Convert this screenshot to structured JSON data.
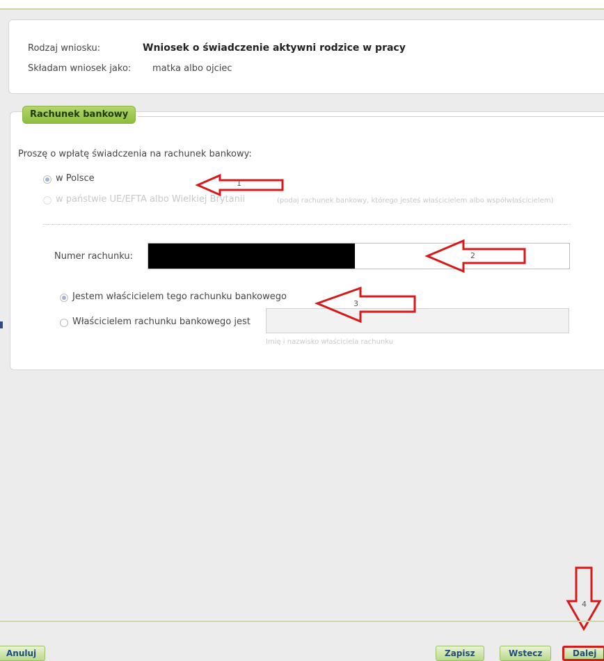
{
  "header": {
    "type_label": "Rodzaj wniosku:",
    "type_value": "Wniosek o świadczenie aktywni rodzice w pracy",
    "as_label": "Składam wniosek jako:",
    "as_value": "matka albo ojciec"
  },
  "bank": {
    "legend": "Rachunek bankowy",
    "prompt": "Proszę o wpłatę świadczenia na rachunek bankowy:",
    "option_poland": "w Polsce",
    "option_eu_main": "w państwie UE/EFTA albo Wielkiej Brytanii",
    "option_eu_hint": "(podaj rachunek bankowy, którego jesteś właścicielem albo współwłaścicielem)",
    "account_label": "Numer rachunku:",
    "owner_self": "Jestem właścicielem tego rachunku bankowego",
    "owner_other": "Właścicielem rachunku bankowego jest",
    "owner_hint": "Imię i nazwisko właściciela rachunku"
  },
  "annotations": [
    "1",
    "2",
    "3",
    "4"
  ],
  "buttons": {
    "cancel": "Anuluj",
    "save": "Zapisz",
    "back": "Wstecz",
    "next": "Dalej"
  },
  "colors": {
    "accent_green": "#8dbd3d",
    "annotation_red": "#d61a1a"
  }
}
